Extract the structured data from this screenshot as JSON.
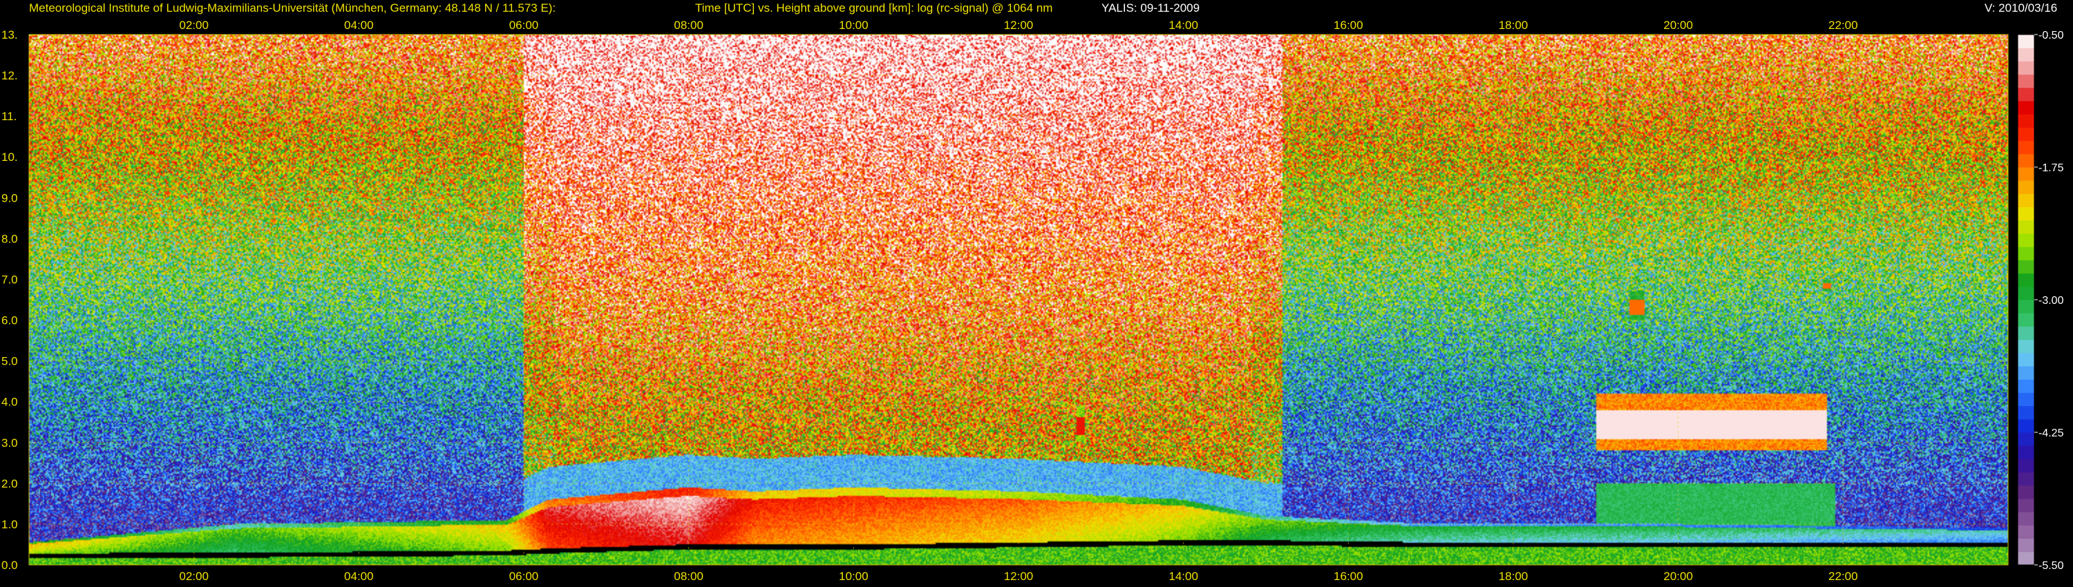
{
  "header": {
    "institute": "Meteorological Institute of Ludwig-Maximilians-Universität (München, Germany: 48.148 N / 11.573 E):",
    "plot_title": "Time [UTC] vs. Height above ground [km]: log (rc-signal) @ 1064 nm",
    "station_date": "YALIS: 09-11-2009",
    "version": "V: 2010/03/16"
  },
  "chart_data": {
    "type": "heatmap",
    "title": "Time [UTC] vs. Height above ground [km]: log (rc-signal) @ 1064 nm",
    "xlabel": "Time [UTC]",
    "ylabel": "Height above ground [km]",
    "x_range": [
      0,
      24
    ],
    "x_ticks": [
      2,
      4,
      6,
      8,
      10,
      12,
      14,
      16,
      18,
      20,
      22
    ],
    "x_tick_labels": [
      "02:00",
      "04:00",
      "06:00",
      "08:00",
      "10:00",
      "12:00",
      "14:00",
      "16:00",
      "18:00",
      "20:00",
      "22:00"
    ],
    "y_range": [
      0,
      13
    ],
    "y_ticks": [
      0,
      1,
      2,
      3,
      4,
      5,
      6,
      7,
      8,
      9,
      10,
      11,
      12,
      13
    ],
    "y_tick_labels": [
      "0.0",
      "1.0",
      "2.0",
      "3.0",
      "4.0",
      "5.0",
      "6.0",
      "7.0",
      "8.0",
      "9.0",
      "10.",
      "11.",
      "12.",
      "13."
    ],
    "grid": true,
    "colorbar": {
      "range": [
        -5.5,
        -0.5
      ],
      "ticks": [
        -0.5,
        -1.75,
        -3.0,
        -4.25,
        -5.5
      ],
      "tick_labels": [
        "-0.50",
        "-1.75",
        "-3.00",
        "-4.25",
        "-5.50"
      ]
    },
    "colormap": [
      "#b8a8c8",
      "#9060a0",
      "#602880",
      "#3010a0",
      "#1030e0",
      "#3080ff",
      "#70d0f0",
      "#30c060",
      "#10a020",
      "#90e000",
      "#f0e000",
      "#ff9000",
      "#ff3000",
      "#e00000",
      "#f0a0a0",
      "#ffffff"
    ],
    "boundary_layer": [
      {
        "t": 0.0,
        "bottom": 0.28,
        "top": 0.55,
        "value": -2.2
      },
      {
        "t": 2.5,
        "bottom": 0.3,
        "top": 1.0,
        "value": -2.9
      },
      {
        "t": 5.8,
        "bottom": 0.35,
        "top": 1.1,
        "value": -2.3
      },
      {
        "t": 6.3,
        "bottom": 0.4,
        "top": 1.6,
        "value": -1.3
      },
      {
        "t": 8.0,
        "bottom": 0.5,
        "top": 1.9,
        "value": -0.9
      },
      {
        "t": 8.8,
        "bottom": 0.5,
        "top": 1.8,
        "value": -1.6
      },
      {
        "t": 10.0,
        "bottom": 0.5,
        "top": 1.9,
        "value": -1.7
      },
      {
        "t": 12.0,
        "bottom": 0.55,
        "top": 1.8,
        "value": -1.9
      },
      {
        "t": 14.0,
        "bottom": 0.6,
        "top": 1.6,
        "value": -2.3
      },
      {
        "t": 15.0,
        "bottom": 0.6,
        "top": 1.2,
        "value": -2.8
      },
      {
        "t": 17.0,
        "bottom": 0.55,
        "top": 1.0,
        "value": -3.2
      },
      {
        "t": 20.0,
        "bottom": 0.55,
        "top": 1.0,
        "value": -3.3
      },
      {
        "t": 24.0,
        "bottom": 0.55,
        "top": 0.9,
        "value": -3.6
      }
    ],
    "cloud_layers": [
      {
        "t_start": 19.0,
        "t_end": 21.8,
        "bottom": 2.8,
        "top": 4.2,
        "value": -0.6
      },
      {
        "t_start": 19.4,
        "t_end": 19.6,
        "bottom": 6.0,
        "top": 6.7,
        "value": -1.7
      },
      {
        "t_start": 21.75,
        "t_end": 21.85,
        "bottom": 6.7,
        "top": 7.0,
        "value": -1.7
      },
      {
        "t_start": 12.7,
        "t_end": 12.8,
        "bottom": 3.0,
        "top": 3.9,
        "value": -1.3
      }
    ]
  }
}
